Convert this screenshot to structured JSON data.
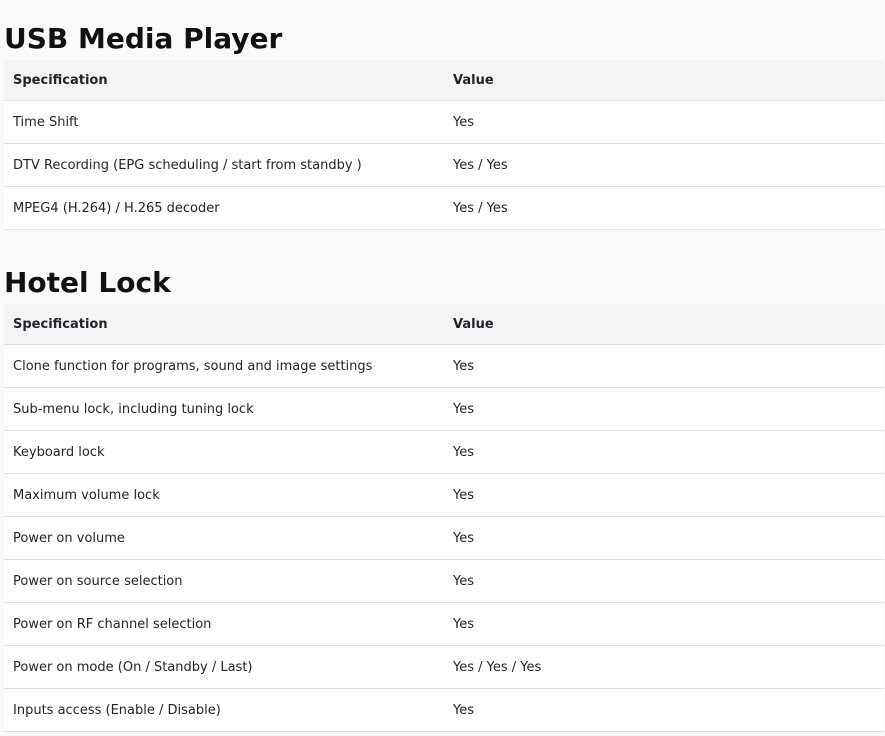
{
  "sections": [
    {
      "title": "USB Media Player",
      "headers": [
        "Specification",
        "Value"
      ],
      "rows": [
        [
          "Time Shift",
          "Yes"
        ],
        [
          "DTV Recording (EPG scheduling / start from standby )",
          "Yes / Yes"
        ],
        [
          "MPEG4 (H.264) / H.265 decoder",
          "Yes / Yes"
        ]
      ]
    },
    {
      "title": "Hotel Lock",
      "headers": [
        "Specification",
        "Value"
      ],
      "rows": [
        [
          "Clone function for programs, sound and image settings",
          "Yes"
        ],
        [
          "Sub-menu lock, including tuning lock",
          "Yes"
        ],
        [
          "Keyboard lock",
          "Yes"
        ],
        [
          "Maximum volume lock",
          "Yes"
        ],
        [
          "Power on volume",
          "Yes"
        ],
        [
          "Power on source selection",
          "Yes"
        ],
        [
          "Power on RF channel selection",
          "Yes"
        ],
        [
          "Power on mode (On / Standby / Last)",
          "Yes / Yes / Yes"
        ],
        [
          "Inputs access (Enable / Disable)",
          "Yes"
        ]
      ]
    }
  ]
}
